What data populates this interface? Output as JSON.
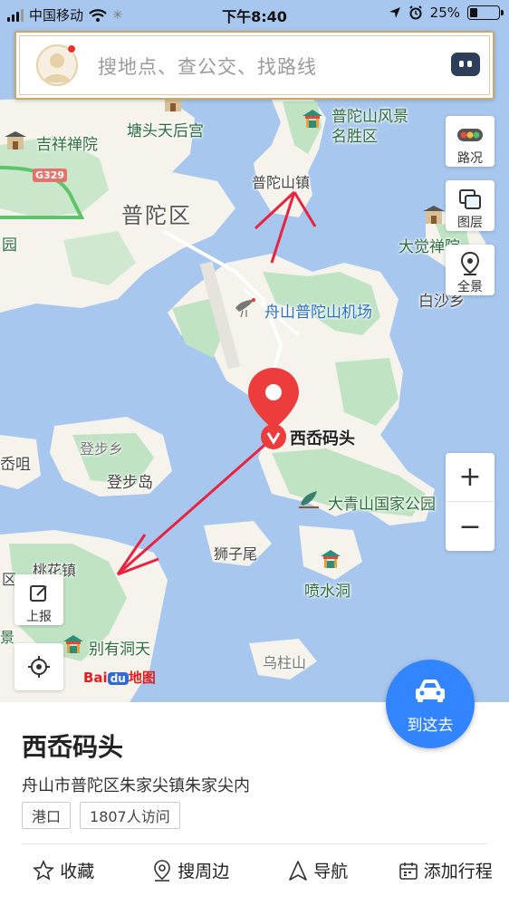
{
  "status_bar": {
    "carrier": "中国移动",
    "time": "下午8:40",
    "battery_percent": "25%",
    "battery_level": 0.25
  },
  "search": {
    "placeholder": "搜地点、查公交、找路线"
  },
  "map_controls": {
    "traffic": "路况",
    "layers": "图层",
    "panorama": "全景",
    "zoom_in": "+",
    "zoom_out": "−",
    "report": "上报"
  },
  "map_labels": {
    "putuo_scenic_1": "普陀山风景",
    "putuo_scenic_2": "名胜区",
    "tangtou_temple": "塘头天后宫",
    "jixiang_temple": "吉祥禅院",
    "highway": "G329",
    "putuo_town": "普陀山镇",
    "putuo_district": "普陀区",
    "dajue_temple": "大觉禅院",
    "yuan": "园",
    "baisha": "白沙乡",
    "airport": "舟山普陀山机场",
    "selected_poi": "西岙码头",
    "dengbu_town": "登步乡",
    "dengbu_island": "登步岛",
    "xiaoju": "岙咀",
    "daqingshan": "大青山国家公园",
    "shizi": "狮子尾",
    "taohua_town": "桃花镇",
    "qu": "区",
    "penshui": "喷水洞",
    "jing": "景",
    "bieyou": "别有洞天",
    "wuzhu": "乌柱山"
  },
  "logo": {
    "bai": "Bai",
    "du": "du",
    "ditu": "地图"
  },
  "go_button": "到这去",
  "place": {
    "name": "西岙码头",
    "address": "舟山市普陀区朱家尖镇朱家尖内",
    "tags": [
      "港口",
      "1807人访问"
    ]
  },
  "actions": [
    {
      "label": "收藏",
      "icon": "star-icon"
    },
    {
      "label": "搜周边",
      "icon": "location-search-icon"
    },
    {
      "label": "导航",
      "icon": "navigation-arrow-icon"
    },
    {
      "label": "添加行程",
      "icon": "calendar-icon"
    }
  ],
  "colors": {
    "water": "#a8c7ee",
    "land": "#f5f3ec",
    "green": "#bfe3c3",
    "accent": "#3385ff",
    "marker": "#ec3c3c",
    "arrow": "#e8233f"
  }
}
